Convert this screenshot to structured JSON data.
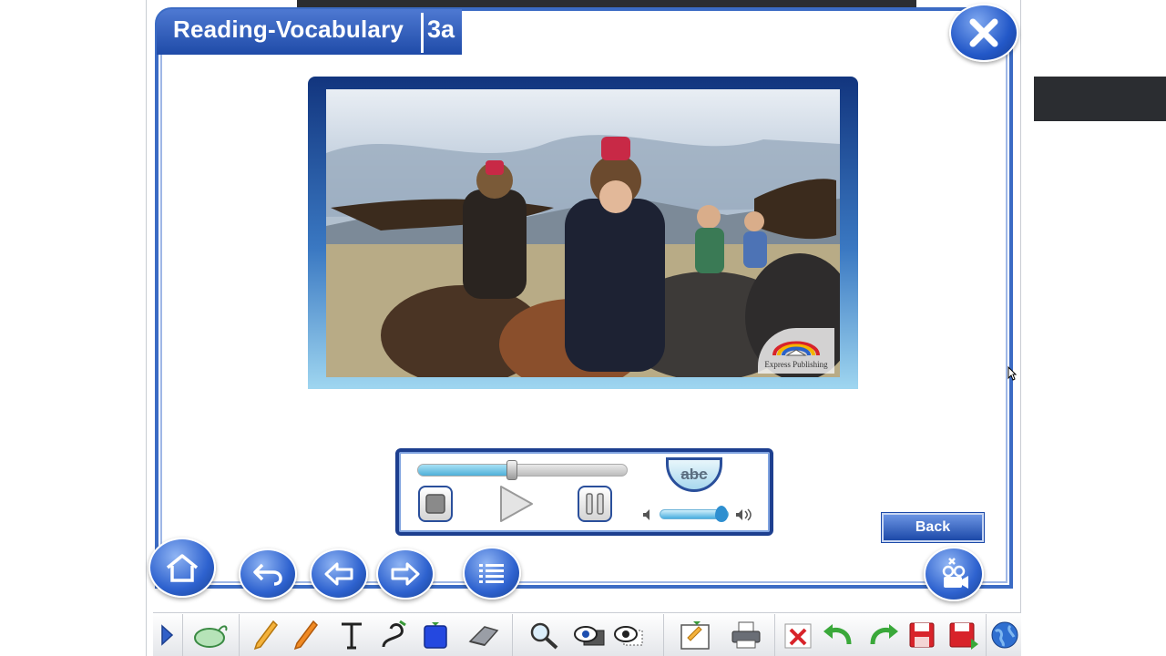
{
  "header": {
    "title": "Reading-Vocabulary",
    "unit": "3a"
  },
  "video": {
    "publisher": "Express Publishing"
  },
  "player": {
    "progress": 0.45,
    "volume": 0.9,
    "subtitles_label": "abc"
  },
  "back_label": "Back",
  "colors": {
    "accent": "#2e62cf",
    "frame": "#3b6bc4"
  }
}
